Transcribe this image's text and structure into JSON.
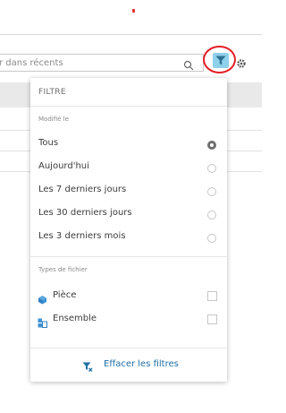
{
  "search": {
    "placeholder": "r dans récents"
  },
  "colors": {
    "accent": "#8fd0ea",
    "highlight": "#e41e26",
    "link": "#1d6fa5"
  },
  "icons": {
    "search": "search-icon",
    "filter": "filter-icon",
    "settings": "gear-icon",
    "part": "part-icon",
    "assembly": "assembly-icon",
    "clear": "clear-filter-icon"
  },
  "filter_menu": {
    "title": "FILTRE",
    "modified_label": "Modifié le",
    "modified_options": [
      {
        "label": "Tous",
        "selected": true
      },
      {
        "label": "Aujourd'hui",
        "selected": false
      },
      {
        "label": "Les 7 derniers jours",
        "selected": false
      },
      {
        "label": "Les 30 derniers jours",
        "selected": false
      },
      {
        "label": "Les 3 derniers mois",
        "selected": false
      }
    ],
    "file_types_label": "Types de fichier",
    "file_types": [
      {
        "label": "Pièce",
        "checked": false
      },
      {
        "label": "Ensemble",
        "checked": false
      }
    ],
    "clear_label": "Effacer les filtres"
  }
}
